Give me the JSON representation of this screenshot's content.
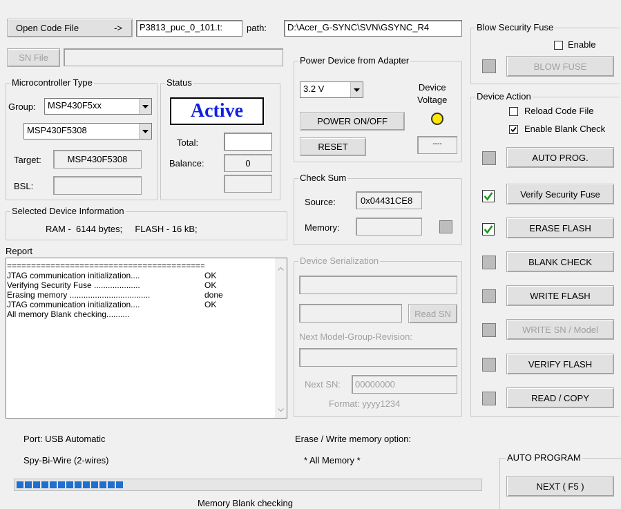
{
  "top": {
    "open_code_file": "Open Code File",
    "arrow": "->",
    "code_file": "P3813_puc_0_101.t:",
    "path_label": "path:",
    "path_value": "D:\\Acer_G-SYNC\\SVN\\GSYNC_R4",
    "sn_file": "SN File",
    "sn_file_value": ""
  },
  "blow_fuse": {
    "title": "Blow Security Fuse",
    "enable": "Enable",
    "button": "BLOW FUSE"
  },
  "power": {
    "title": "Power Device from Adapter",
    "voltage_value": "3.2 V",
    "device_voltage": "Device\nVoltage",
    "power_button": "POWER ON/OFF",
    "reset_button": "RESET",
    "voltage_readout": "----",
    "led_color": "#ffe800"
  },
  "mcu": {
    "title": "Microcontroller Type",
    "group_label": "Group:",
    "group_value": "MSP430F5xx",
    "device_value": "MSP430F5308",
    "target_label": "Target:",
    "target_value": "MSP430F5308",
    "bsl_label": "BSL:",
    "bsl_value": ""
  },
  "status": {
    "title": "Status",
    "active": "Active",
    "total_label": "Total:",
    "total_value": "",
    "balance_label": "Balance:",
    "balance_value": "0",
    "extra_value": ""
  },
  "checksum": {
    "title": "Check Sum",
    "source_label": "Source:",
    "source_value": "0x04431CE8",
    "memory_label": "Memory:",
    "memory_value": ""
  },
  "selected": {
    "title": "Selected Device Information",
    "info": "RAM -  6144 bytes;     FLASH - 16 kB;"
  },
  "report": {
    "title": "Report",
    "lines": [
      {
        "text": "=========================================",
        "status": ""
      },
      {
        "text": "JTAG communication initialization....",
        "status": "OK"
      },
      {
        "text": "Verifying Security Fuse ....................",
        "status": "OK"
      },
      {
        "text": "Erasing memory ...................................",
        "status": "done"
      },
      {
        "text": "JTAG communication initialization....",
        "status": "OK"
      },
      {
        "text": "All memory Blank checking..........",
        "status": ""
      }
    ]
  },
  "serial": {
    "title": "Device Serialization",
    "read_sn": "Read SN",
    "next_model_label": "Next Model-Group-Revision:",
    "next_sn_label": "Next SN:",
    "next_sn_value": "00000000",
    "format": "Format: yyyy1234"
  },
  "actions": {
    "title": "Device Action",
    "reload": "Reload Code File",
    "blank_check": "Enable Blank Check",
    "auto_prog": "AUTO PROG.",
    "verify_fuse": "Verify Security Fuse",
    "erase_flash": "ERASE FLASH",
    "blank_check_btn": "BLANK CHECK",
    "write_flash": "WRITE FLASH",
    "write_sn": "WRITE SN / Model",
    "verify_flash": "VERIFY FLASH",
    "read_copy": "READ / COPY",
    "check_color": "#1a9a1a"
  },
  "bottom": {
    "port": "Port: USB Automatic",
    "spy": "Spy-Bi-Wire (2-wires)",
    "erase_option": "Erase / Write memory option:",
    "all_memory": "* All Memory *",
    "auto_program": "AUTO PROGRAM",
    "next": "NEXT  ( F5 )",
    "status_text": "Memory Blank checking",
    "progress_color": "#1e6fd0",
    "progress_segments": 13
  }
}
